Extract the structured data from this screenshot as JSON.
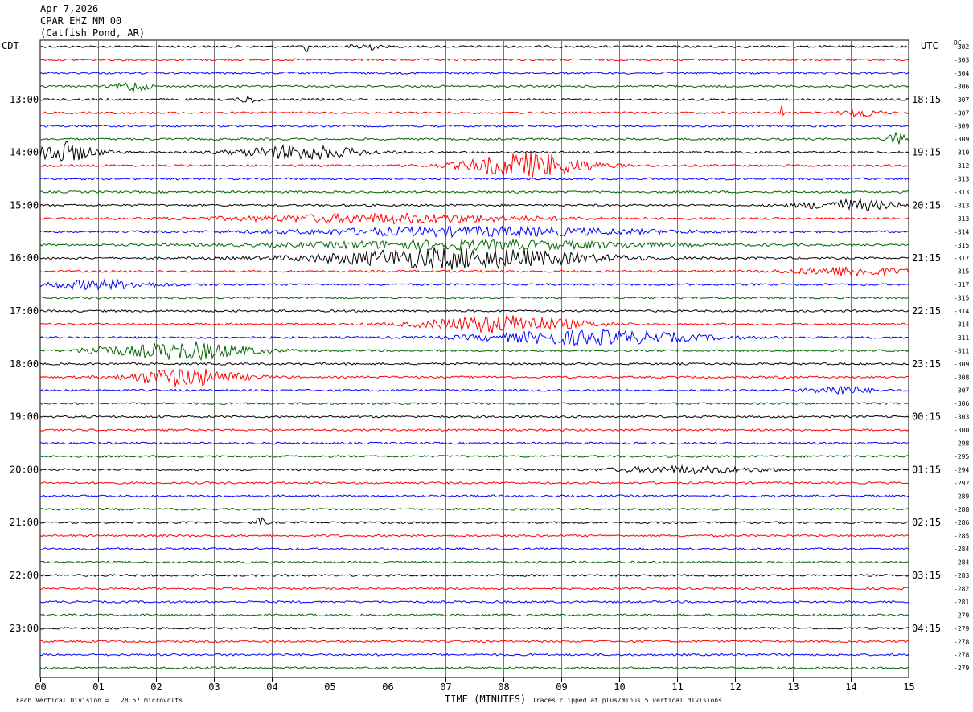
{
  "header": {
    "date": "Apr 7,2026",
    "station": "CPAR EHZ NM 00",
    "location": "(Catfish Pond, AR)"
  },
  "axis_labels": {
    "left_tz": "CDT",
    "right_tz": "UTC",
    "dc": "DC",
    "xlabel": "TIME (MINUTES)",
    "vertical_division": "Each Vertical Division =   28.57 microvolts",
    "clip_note": "Traces clipped at plus/minus 5 vertical divisions"
  },
  "chart_data": {
    "type": "line",
    "title": "",
    "xlabel": "TIME (MINUTES)",
    "xlim": [
      0,
      15
    ],
    "x_ticks": [
      "00",
      "01",
      "02",
      "03",
      "04",
      "05",
      "06",
      "07",
      "08",
      "09",
      "10",
      "11",
      "12",
      "13",
      "14",
      "15"
    ],
    "left_hour_labels": [
      "13:00",
      "14:00",
      "15:00",
      "16:00",
      "17:00",
      "18:00",
      "19:00",
      "20:00",
      "21:00",
      "22:00",
      "23:00"
    ],
    "right_hour_labels": [
      "18:15",
      "19:15",
      "20:15",
      "21:15",
      "22:15",
      "23:15",
      "00:15",
      "01:15",
      "02:15",
      "03:15",
      "04:15"
    ],
    "dc_offsets": [
      "-302",
      "-303",
      "-304",
      "-306",
      "-307",
      "-307",
      "-309",
      "-309",
      "-310",
      "-312",
      "-313",
      "-313",
      "-313",
      "-313",
      "-314",
      "-315",
      "-317",
      "-315",
      "-317",
      "-315",
      "-314",
      "-314",
      "-311",
      "-311",
      "-309",
      "-308",
      "-307",
      "-306",
      "-303",
      "-300",
      "-298",
      "-295",
      "-294",
      "-292",
      "-289",
      "-288",
      "-286",
      "-285",
      "-284",
      "-284",
      "-283",
      "-282",
      "-281",
      "-279",
      "-279",
      "-278",
      "-278",
      "-279"
    ],
    "trace_colors": [
      "#000000",
      "#ff0000",
      "#0000ff",
      "#006400"
    ],
    "traces_per_hour": 4,
    "minutes_per_trace": 15,
    "events": [
      {
        "trace": 0,
        "minute": 4.6,
        "amp": 8,
        "dur": 0.05
      },
      {
        "trace": 0,
        "minute": 5.6,
        "amp": 2.5,
        "dur": 0.4
      },
      {
        "trace": 3,
        "minute": 1.6,
        "amp": 3,
        "dur": 0.5
      },
      {
        "trace": 4,
        "minute": 3.6,
        "amp": 2,
        "dur": 0.3
      },
      {
        "trace": 5,
        "minute": 12.8,
        "amp": 5,
        "dur": 0.05
      },
      {
        "trace": 5,
        "minute": 14.2,
        "amp": 2.5,
        "dur": 0.6
      },
      {
        "trace": 7,
        "minute": 14.8,
        "amp": 4,
        "dur": 0.3
      },
      {
        "trace": 8,
        "minute": 0.3,
        "amp": 6,
        "dur": 1.2
      },
      {
        "trace": 8,
        "minute": 4.5,
        "amp": 4,
        "dur": 2.0
      },
      {
        "trace": 9,
        "minute": 8.4,
        "amp": 7,
        "dur": 2.0
      },
      {
        "trace": 12,
        "minute": 14.0,
        "amp": 3,
        "dur": 1.6
      },
      {
        "trace": 13,
        "minute": 6,
        "amp": 2.5,
        "dur": 5.0
      },
      {
        "trace": 14,
        "minute": 7.5,
        "amp": 2.5,
        "dur": 6.0
      },
      {
        "trace": 15,
        "minute": 7.5,
        "amp": 2.5,
        "dur": 6.0
      },
      {
        "trace": 16,
        "minute": 7.2,
        "amp": 6,
        "dur": 4.5
      },
      {
        "trace": 17,
        "minute": 14.0,
        "amp": 2.5,
        "dur": 2.0
      },
      {
        "trace": 18,
        "minute": 1.0,
        "amp": 2.5,
        "dur": 2.0
      },
      {
        "trace": 21,
        "minute": 8.0,
        "amp": 5,
        "dur": 2.5
      },
      {
        "trace": 22,
        "minute": 9.5,
        "amp": 4,
        "dur": 3.5
      },
      {
        "trace": 23,
        "minute": 2.5,
        "amp": 5,
        "dur": 2.2
      },
      {
        "trace": 23,
        "minute": 1.0,
        "amp": 2.5,
        "dur": 0.5
      },
      {
        "trace": 25,
        "minute": 2.5,
        "amp": 5,
        "dur": 1.8
      },
      {
        "trace": 26,
        "minute": 13.8,
        "amp": 2.5,
        "dur": 1.0
      },
      {
        "trace": 32,
        "minute": 11.2,
        "amp": 1.8,
        "dur": 2.5
      },
      {
        "trace": 36,
        "minute": 3.8,
        "amp": 2.5,
        "dur": 0.2
      }
    ]
  }
}
